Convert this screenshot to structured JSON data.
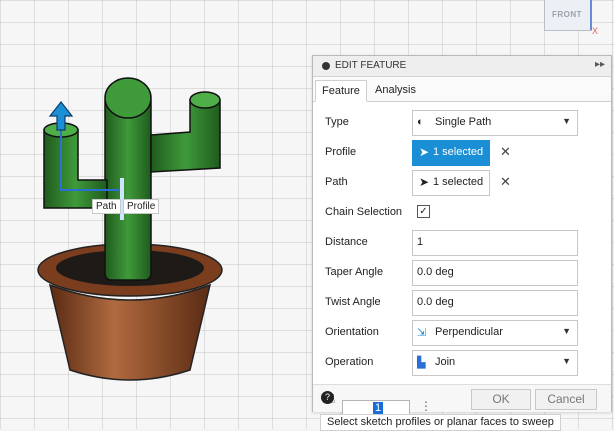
{
  "viewcube": {
    "label": "FRONT",
    "axis_x": "X"
  },
  "canvas_tags": {
    "path": "Path",
    "profile": "Profile"
  },
  "panel": {
    "title": "EDIT FEATURE",
    "collapse": "▸▸",
    "tabs": [
      "Feature",
      "Analysis"
    ],
    "rows": {
      "type": {
        "label": "Type",
        "value": "Single Path"
      },
      "profile": {
        "label": "Profile",
        "value": "1 selected"
      },
      "path": {
        "label": "Path",
        "value": "1 selected"
      },
      "chain": {
        "label": "Chain Selection",
        "checked": "✓"
      },
      "distance": {
        "label": "Distance",
        "value": "1"
      },
      "taper": {
        "label": "Taper Angle",
        "value": "0.0 deg"
      },
      "twist": {
        "label": "Twist Angle",
        "value": "0.0 deg"
      },
      "orientation": {
        "label": "Orientation",
        "value": "Perpendicular"
      },
      "operation": {
        "label": "Operation",
        "value": "Join"
      }
    },
    "ok": "OK",
    "cancel": "Cancel"
  },
  "status": {
    "input_value": "1",
    "tooltip": "Select sketch profiles or planar faces to sweep"
  },
  "colors": {
    "accent": "#1a8fd6",
    "cactus": "#2f7a2c",
    "pot": "#8c4a2a"
  }
}
